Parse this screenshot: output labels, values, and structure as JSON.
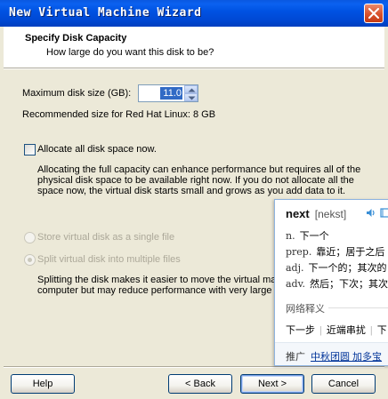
{
  "window": {
    "title": "New Virtual Machine Wizard"
  },
  "header": {
    "title": "Specify Disk Capacity",
    "subtitle": "How large do you want this disk to be?"
  },
  "capacity": {
    "max_size_label": "Maximum disk size (GB):",
    "max_size_value": "11.0",
    "recommended": "Recommended size for Red Hat Linux: 8 GB"
  },
  "allocate": {
    "label": "Allocate all disk space now.",
    "checked": false,
    "desc_lines": [
      "Allocating the full capacity can enhance performance but requires all of the",
      "physical disk space to be available right now. If you do not allocate all the",
      "space now, the virtual disk starts small and grows as you add data to it."
    ]
  },
  "storage": {
    "single_label": "Store virtual disk as a single file",
    "split_label": "Split virtual disk into multiple files",
    "split_desc_lines": [
      "Splitting the disk makes it easier to move the virtual machine to another",
      "computer but may reduce performance with very large disks."
    ]
  },
  "buttons": {
    "help": "Help",
    "back": "< Back",
    "next": "Next >",
    "cancel": "Cancel"
  },
  "dictionary": {
    "word": "next",
    "phonetic": "[nekst]",
    "definitions": [
      {
        "pos": "n.",
        "text": "下一个"
      },
      {
        "pos": "prep.",
        "text": "靠近；居于之后"
      },
      {
        "pos": "adj.",
        "text": "下一个的；其次的"
      },
      {
        "pos": "adv.",
        "text": "然后；下次；其次"
      }
    ],
    "section_label": "网络释义",
    "phrases": [
      "下一步",
      "近端串扰",
      "下"
    ],
    "promo_label": "推广",
    "promo_link": "中秋团圆 加多宝"
  },
  "colors": {
    "titlebar": "#0053e3",
    "dialog_bg": "#ece9d8",
    "selection": "#316ac5",
    "disabled_text": "#aca899",
    "dict_link": "#003399"
  }
}
